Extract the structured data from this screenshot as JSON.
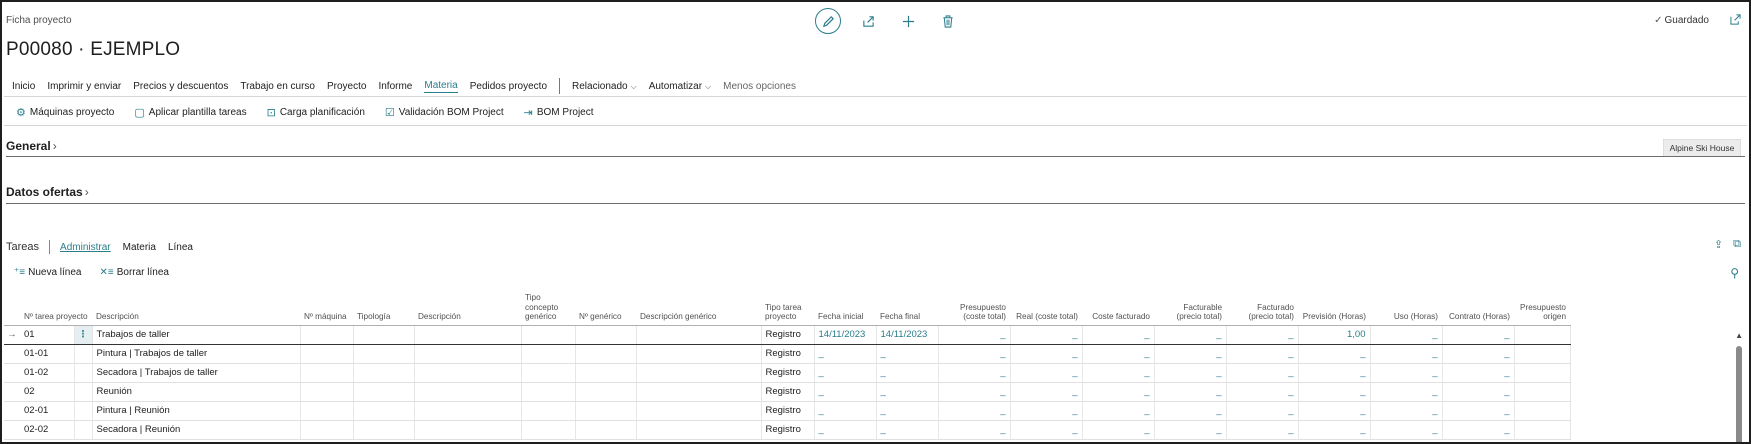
{
  "header": {
    "breadcrumb": "Ficha proyecto",
    "title": "P00080 · EJEMPLO",
    "status": "Guardado"
  },
  "menu": [
    {
      "label": "Inicio"
    },
    {
      "label": "Imprimir y enviar"
    },
    {
      "label": "Precios y descuentos"
    },
    {
      "label": "Trabajo en curso"
    },
    {
      "label": "Proyecto"
    },
    {
      "label": "Informe"
    },
    {
      "label": "Materia",
      "active": true
    },
    {
      "label": "Pedidos proyecto"
    }
  ],
  "menu_dropdowns": [
    {
      "label": "Relacionado"
    },
    {
      "label": "Automatizar"
    }
  ],
  "menu_less": "Menos opciones",
  "actions": [
    {
      "label": "Máquinas proyecto",
      "icon": "machine-icon"
    },
    {
      "label": "Aplicar plantilla tareas",
      "icon": "template-icon"
    },
    {
      "label": "Carga planificación",
      "icon": "planning-icon"
    },
    {
      "label": "Validación BOM Project",
      "icon": "validate-icon"
    },
    {
      "label": "BOM Project",
      "icon": "bom-icon"
    }
  ],
  "sections": {
    "general": "General",
    "offers": "Datos ofertas",
    "customer_tag": "Alpine Ski House"
  },
  "tasks": {
    "label": "Tareas",
    "tabs": [
      "Administrar",
      "Materia",
      "Línea"
    ],
    "new_line": "Nueva línea",
    "delete_line": "Borrar línea"
  },
  "grid": {
    "columns": [
      "Nº tarea proyecto",
      "Descripción",
      "Nº máquina",
      "Tipología",
      "Descripción",
      "Tipo concepto genérico",
      "Nº genérico",
      "Descripción genérico",
      "Tipo tarea proyecto",
      "Fecha inicial",
      "Fecha final",
      "Presupuesto (coste total)",
      "Real (coste total)",
      "Coste facturado",
      "Facturable (precio total)",
      "Facturado (precio total)",
      "Previsión (Horas)",
      "Uso (Horas)",
      "Contrato (Horas)",
      "Presupuesto origen"
    ],
    "rows": [
      {
        "no": "01",
        "desc": "Trabajos de taller",
        "type": "Registro",
        "start": "14/11/2023",
        "end": "14/11/2023",
        "forecast": "1,00"
      },
      {
        "no": "01-01",
        "desc": "Pintura | Trabajos de taller",
        "type": "Registro",
        "start": "_",
        "end": "_",
        "forecast": "_"
      },
      {
        "no": "01-02",
        "desc": "Secadora | Trabajos de taller",
        "type": "Registro",
        "start": "_",
        "end": "_",
        "forecast": "_"
      },
      {
        "no": "02",
        "desc": "Reunión",
        "type": "Registro",
        "start": "_",
        "end": "_",
        "forecast": "_"
      },
      {
        "no": "02-01",
        "desc": "Pintura | Reunión",
        "type": "Registro",
        "start": "_",
        "end": "_",
        "forecast": "_"
      },
      {
        "no": "02-02",
        "desc": "Secadora | Reunión",
        "type": "Registro",
        "start": "_",
        "end": "_",
        "forecast": "_"
      }
    ],
    "empty_value": "_",
    "row_marker": "→"
  },
  "colors": {
    "accent": "#2a7d8c"
  }
}
